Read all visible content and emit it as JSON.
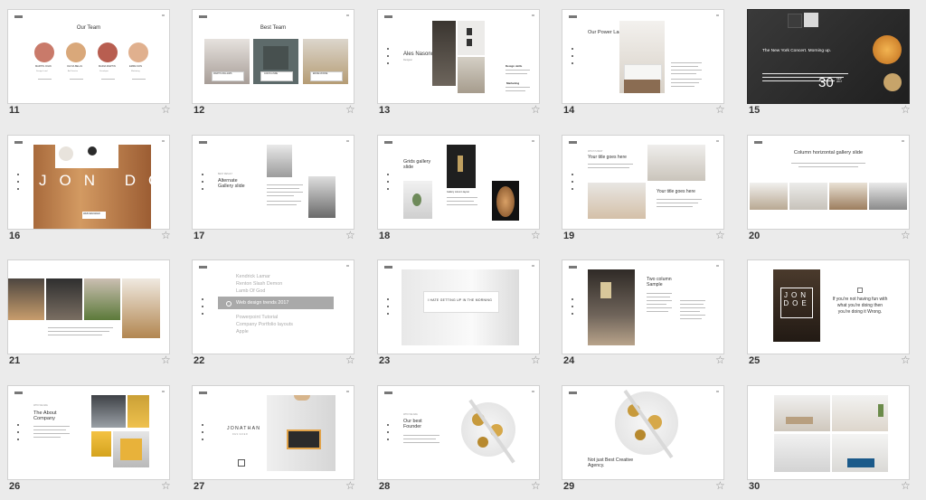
{
  "slides": [
    {
      "number": "11",
      "title": "Our Team",
      "members": [
        {
          "name": "MARTIN JOHN",
          "role": "Design Lead"
        },
        {
          "name": "OLIVIA BELLS",
          "role": "Art Director"
        },
        {
          "name": "MARIA MARTIN",
          "role": "Developer"
        },
        {
          "name": "EMMA SON",
          "role": "Marketing"
        }
      ]
    },
    {
      "number": "12",
      "title": "Best Team",
      "captions": [
        "MARTIN WILLIAMS",
        "JASON LINDE",
        "EDDIE MOORE"
      ]
    },
    {
      "number": "13",
      "title": "Ales Nasonov",
      "subtitle": "Designer",
      "labels": [
        "Design skills",
        "Marketing"
      ]
    },
    {
      "number": "14",
      "title": "Our Power Ladies"
    },
    {
      "number": "15",
      "title": "The New York Concert. Morning up.",
      "day": "30",
      "month": "SEP 2017"
    },
    {
      "number": "16",
      "title": "JON DOE",
      "caption": "WEB DESIGNER"
    },
    {
      "number": "17",
      "kicker": "BEST RESULT",
      "title": "Alternate Gallery slide"
    },
    {
      "number": "18",
      "title": "Grids gallery slide",
      "caption": "Gallery column layout"
    },
    {
      "number": "19",
      "kicker": "WHAT IS BEST",
      "title": "Your title goes here",
      "title2": "Your title goes here"
    },
    {
      "number": "20",
      "title": "Column horizontal gallery slide"
    },
    {
      "number": "21"
    },
    {
      "number": "22",
      "menu": [
        "Kendrick Lamar",
        "Renton Slash Demon",
        "Lamb Of God",
        "Web design trends 2017",
        "Powerpoint Tutorial",
        "Company Portfolio layouts",
        "Apple"
      ]
    },
    {
      "number": "23",
      "quote": "I HATE GETTING UP IN THE MORNING"
    },
    {
      "number": "24",
      "title": "Two column Sample"
    },
    {
      "number": "25",
      "title": "JON DOE",
      "quote": "If you're not having fun with what you're doing then you're doing it Wrong."
    },
    {
      "number": "26",
      "kicker": "WHO WE ARE",
      "title": "The About Company"
    },
    {
      "number": "27",
      "title": "JONATHAN",
      "subtitle": "DESIGNER"
    },
    {
      "number": "28",
      "kicker": "WHO WE ARE",
      "title": "Our best Founder"
    },
    {
      "number": "29",
      "title": "Not just Best Creative Agency."
    },
    {
      "number": "30"
    }
  ],
  "star_icon": "☆",
  "colors": {
    "background": "#ebebeb",
    "slide": "#ffffff",
    "dark_slide": "#2a2a2a",
    "star": "#8a8a8a",
    "accent_gold": "#e8a13a"
  }
}
